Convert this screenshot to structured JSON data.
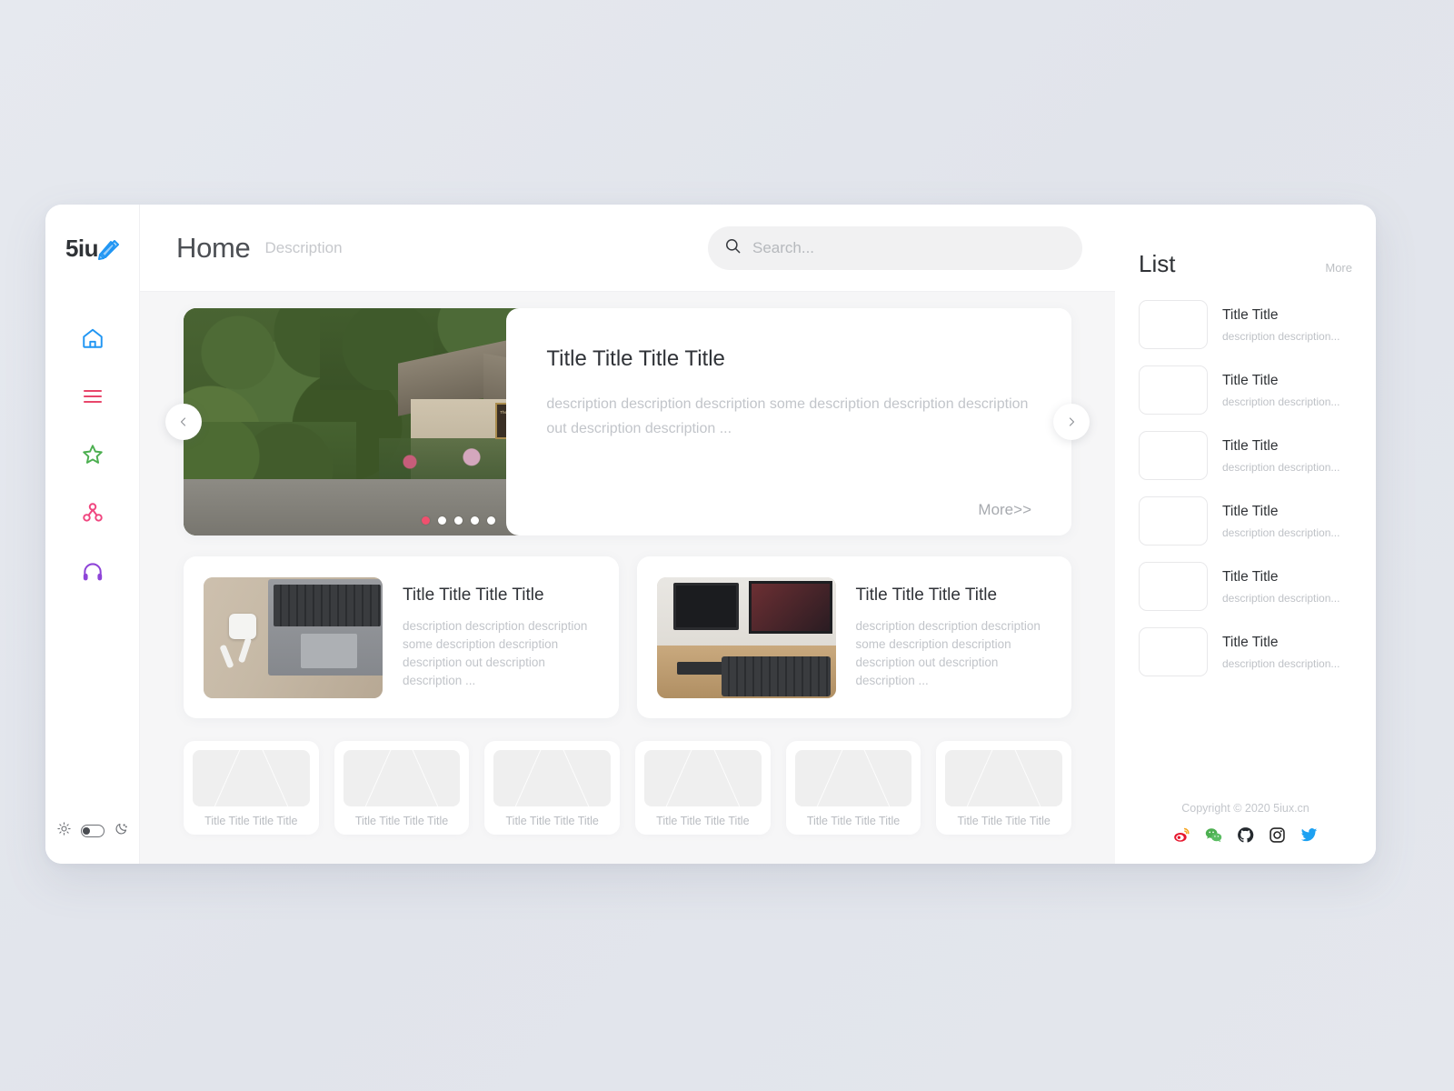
{
  "brand": {
    "name": "5iu",
    "logo_icon": "pen-ruler-icon",
    "accent": "#2196f3"
  },
  "sidebar": {
    "items": [
      {
        "icon": "home-icon",
        "name": "home",
        "color": "#2196f3",
        "active": true
      },
      {
        "icon": "list-icon",
        "name": "list",
        "color": "#e8466b",
        "active": false
      },
      {
        "icon": "star-icon",
        "name": "favorites",
        "color": "#4caf50",
        "active": false
      },
      {
        "icon": "share-icon",
        "name": "share",
        "color": "#f0467f",
        "active": false
      },
      {
        "icon": "headphones-icon",
        "name": "audio",
        "color": "#8e44d8",
        "active": false
      }
    ],
    "theme_toggle": {
      "light_icon": "sun-icon",
      "dark_icon": "moon-icon",
      "state": "light"
    }
  },
  "header": {
    "title": "Home",
    "subtitle": "Description",
    "search": {
      "icon": "search-icon",
      "value": "",
      "placeholder": "Search..."
    }
  },
  "hero": {
    "prev_icon": "chevron-left-icon",
    "next_icon": "chevron-right-icon",
    "image_alt": "village street with stone cottages",
    "image_sign": "The Old Post Office",
    "title": "Title Title Title Title",
    "description": "description description description some description description description out description description ...",
    "more_label": "More>>",
    "dots": [
      {
        "active": true
      },
      {
        "active": false
      },
      {
        "active": false
      },
      {
        "active": false
      },
      {
        "active": false
      }
    ]
  },
  "features": [
    {
      "image_alt": "laptop and wireless earbuds on wooden desk",
      "title": "Title Title Title Title",
      "description": "description description description some description description description out description description ..."
    },
    {
      "image_alt": "desktop monitors and laptop on office desk",
      "title": "Title Title Title Title",
      "description": "description description description some description description description out description description ..."
    }
  ],
  "thumbnails": [
    {
      "label": "Title Title Title Title"
    },
    {
      "label": "Title Title Title Title"
    },
    {
      "label": "Title Title Title Title"
    },
    {
      "label": "Title Title Title Title"
    },
    {
      "label": "Title Title Title Title"
    },
    {
      "label": "Title Title Title Title"
    }
  ],
  "list_panel": {
    "title": "List",
    "more_label": "More",
    "items": [
      {
        "title": "Title Title",
        "description": "description description..."
      },
      {
        "title": "Title Title",
        "description": "description description..."
      },
      {
        "title": "Title Title",
        "description": "description description..."
      },
      {
        "title": "Title Title",
        "description": "description description..."
      },
      {
        "title": "Title Title",
        "description": "description description..."
      },
      {
        "title": "Title Title",
        "description": "description description..."
      }
    ],
    "footer": {
      "copyright": "Copyright © 2020 5iux.cn",
      "socials": [
        {
          "name": "weibo-icon",
          "color": "#e6162d"
        },
        {
          "name": "wechat-icon",
          "color": "#4caf50"
        },
        {
          "name": "github-icon",
          "color": "#24292e"
        },
        {
          "name": "instagram-icon",
          "color": "#262626"
        },
        {
          "name": "twitter-icon",
          "color": "#1da1f2"
        }
      ]
    }
  }
}
